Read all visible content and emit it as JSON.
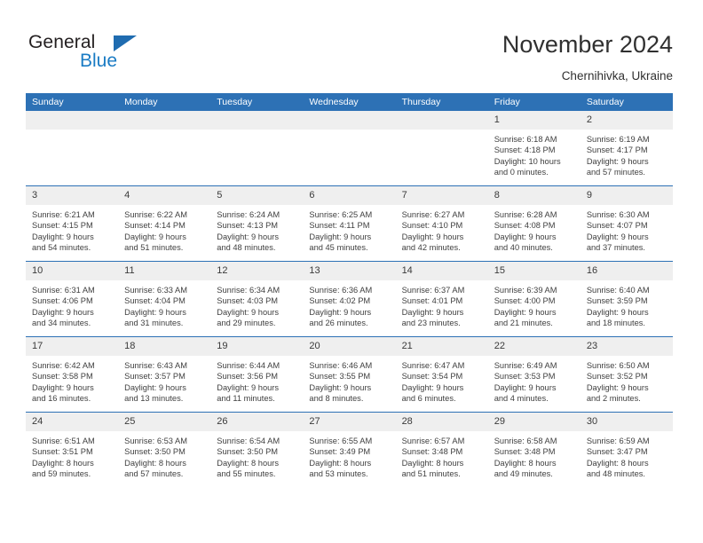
{
  "brand": {
    "name_part1": "General",
    "name_part2": "Blue",
    "accent_color": "#1f6cb0",
    "blue_text_color": "#1a7bc4"
  },
  "header": {
    "title": "November 2024",
    "location": "Chernihivka, Ukraine",
    "header_bg_color": "#2d71b5",
    "daynum_bg_color": "#efefef"
  },
  "weekdays": [
    "Sunday",
    "Monday",
    "Tuesday",
    "Wednesday",
    "Thursday",
    "Friday",
    "Saturday"
  ],
  "weeks": [
    [
      {
        "day": "",
        "sunrise": "",
        "sunset": "",
        "daylight1": "",
        "daylight2": ""
      },
      {
        "day": "",
        "sunrise": "",
        "sunset": "",
        "daylight1": "",
        "daylight2": ""
      },
      {
        "day": "",
        "sunrise": "",
        "sunset": "",
        "daylight1": "",
        "daylight2": ""
      },
      {
        "day": "",
        "sunrise": "",
        "sunset": "",
        "daylight1": "",
        "daylight2": ""
      },
      {
        "day": "",
        "sunrise": "",
        "sunset": "",
        "daylight1": "",
        "daylight2": ""
      },
      {
        "day": "1",
        "sunrise": "Sunrise: 6:18 AM",
        "sunset": "Sunset: 4:18 PM",
        "daylight1": "Daylight: 10 hours",
        "daylight2": "and 0 minutes."
      },
      {
        "day": "2",
        "sunrise": "Sunrise: 6:19 AM",
        "sunset": "Sunset: 4:17 PM",
        "daylight1": "Daylight: 9 hours",
        "daylight2": "and 57 minutes."
      }
    ],
    [
      {
        "day": "3",
        "sunrise": "Sunrise: 6:21 AM",
        "sunset": "Sunset: 4:15 PM",
        "daylight1": "Daylight: 9 hours",
        "daylight2": "and 54 minutes."
      },
      {
        "day": "4",
        "sunrise": "Sunrise: 6:22 AM",
        "sunset": "Sunset: 4:14 PM",
        "daylight1": "Daylight: 9 hours",
        "daylight2": "and 51 minutes."
      },
      {
        "day": "5",
        "sunrise": "Sunrise: 6:24 AM",
        "sunset": "Sunset: 4:13 PM",
        "daylight1": "Daylight: 9 hours",
        "daylight2": "and 48 minutes."
      },
      {
        "day": "6",
        "sunrise": "Sunrise: 6:25 AM",
        "sunset": "Sunset: 4:11 PM",
        "daylight1": "Daylight: 9 hours",
        "daylight2": "and 45 minutes."
      },
      {
        "day": "7",
        "sunrise": "Sunrise: 6:27 AM",
        "sunset": "Sunset: 4:10 PM",
        "daylight1": "Daylight: 9 hours",
        "daylight2": "and 42 minutes."
      },
      {
        "day": "8",
        "sunrise": "Sunrise: 6:28 AM",
        "sunset": "Sunset: 4:08 PM",
        "daylight1": "Daylight: 9 hours",
        "daylight2": "and 40 minutes."
      },
      {
        "day": "9",
        "sunrise": "Sunrise: 6:30 AM",
        "sunset": "Sunset: 4:07 PM",
        "daylight1": "Daylight: 9 hours",
        "daylight2": "and 37 minutes."
      }
    ],
    [
      {
        "day": "10",
        "sunrise": "Sunrise: 6:31 AM",
        "sunset": "Sunset: 4:06 PM",
        "daylight1": "Daylight: 9 hours",
        "daylight2": "and 34 minutes."
      },
      {
        "day": "11",
        "sunrise": "Sunrise: 6:33 AM",
        "sunset": "Sunset: 4:04 PM",
        "daylight1": "Daylight: 9 hours",
        "daylight2": "and 31 minutes."
      },
      {
        "day": "12",
        "sunrise": "Sunrise: 6:34 AM",
        "sunset": "Sunset: 4:03 PM",
        "daylight1": "Daylight: 9 hours",
        "daylight2": "and 29 minutes."
      },
      {
        "day": "13",
        "sunrise": "Sunrise: 6:36 AM",
        "sunset": "Sunset: 4:02 PM",
        "daylight1": "Daylight: 9 hours",
        "daylight2": "and 26 minutes."
      },
      {
        "day": "14",
        "sunrise": "Sunrise: 6:37 AM",
        "sunset": "Sunset: 4:01 PM",
        "daylight1": "Daylight: 9 hours",
        "daylight2": "and 23 minutes."
      },
      {
        "day": "15",
        "sunrise": "Sunrise: 6:39 AM",
        "sunset": "Sunset: 4:00 PM",
        "daylight1": "Daylight: 9 hours",
        "daylight2": "and 21 minutes."
      },
      {
        "day": "16",
        "sunrise": "Sunrise: 6:40 AM",
        "sunset": "Sunset: 3:59 PM",
        "daylight1": "Daylight: 9 hours",
        "daylight2": "and 18 minutes."
      }
    ],
    [
      {
        "day": "17",
        "sunrise": "Sunrise: 6:42 AM",
        "sunset": "Sunset: 3:58 PM",
        "daylight1": "Daylight: 9 hours",
        "daylight2": "and 16 minutes."
      },
      {
        "day": "18",
        "sunrise": "Sunrise: 6:43 AM",
        "sunset": "Sunset: 3:57 PM",
        "daylight1": "Daylight: 9 hours",
        "daylight2": "and 13 minutes."
      },
      {
        "day": "19",
        "sunrise": "Sunrise: 6:44 AM",
        "sunset": "Sunset: 3:56 PM",
        "daylight1": "Daylight: 9 hours",
        "daylight2": "and 11 minutes."
      },
      {
        "day": "20",
        "sunrise": "Sunrise: 6:46 AM",
        "sunset": "Sunset: 3:55 PM",
        "daylight1": "Daylight: 9 hours",
        "daylight2": "and 8 minutes."
      },
      {
        "day": "21",
        "sunrise": "Sunrise: 6:47 AM",
        "sunset": "Sunset: 3:54 PM",
        "daylight1": "Daylight: 9 hours",
        "daylight2": "and 6 minutes."
      },
      {
        "day": "22",
        "sunrise": "Sunrise: 6:49 AM",
        "sunset": "Sunset: 3:53 PM",
        "daylight1": "Daylight: 9 hours",
        "daylight2": "and 4 minutes."
      },
      {
        "day": "23",
        "sunrise": "Sunrise: 6:50 AM",
        "sunset": "Sunset: 3:52 PM",
        "daylight1": "Daylight: 9 hours",
        "daylight2": "and 2 minutes."
      }
    ],
    [
      {
        "day": "24",
        "sunrise": "Sunrise: 6:51 AM",
        "sunset": "Sunset: 3:51 PM",
        "daylight1": "Daylight: 8 hours",
        "daylight2": "and 59 minutes."
      },
      {
        "day": "25",
        "sunrise": "Sunrise: 6:53 AM",
        "sunset": "Sunset: 3:50 PM",
        "daylight1": "Daylight: 8 hours",
        "daylight2": "and 57 minutes."
      },
      {
        "day": "26",
        "sunrise": "Sunrise: 6:54 AM",
        "sunset": "Sunset: 3:50 PM",
        "daylight1": "Daylight: 8 hours",
        "daylight2": "and 55 minutes."
      },
      {
        "day": "27",
        "sunrise": "Sunrise: 6:55 AM",
        "sunset": "Sunset: 3:49 PM",
        "daylight1": "Daylight: 8 hours",
        "daylight2": "and 53 minutes."
      },
      {
        "day": "28",
        "sunrise": "Sunrise: 6:57 AM",
        "sunset": "Sunset: 3:48 PM",
        "daylight1": "Daylight: 8 hours",
        "daylight2": "and 51 minutes."
      },
      {
        "day": "29",
        "sunrise": "Sunrise: 6:58 AM",
        "sunset": "Sunset: 3:48 PM",
        "daylight1": "Daylight: 8 hours",
        "daylight2": "and 49 minutes."
      },
      {
        "day": "30",
        "sunrise": "Sunrise: 6:59 AM",
        "sunset": "Sunset: 3:47 PM",
        "daylight1": "Daylight: 8 hours",
        "daylight2": "and 48 minutes."
      }
    ]
  ]
}
